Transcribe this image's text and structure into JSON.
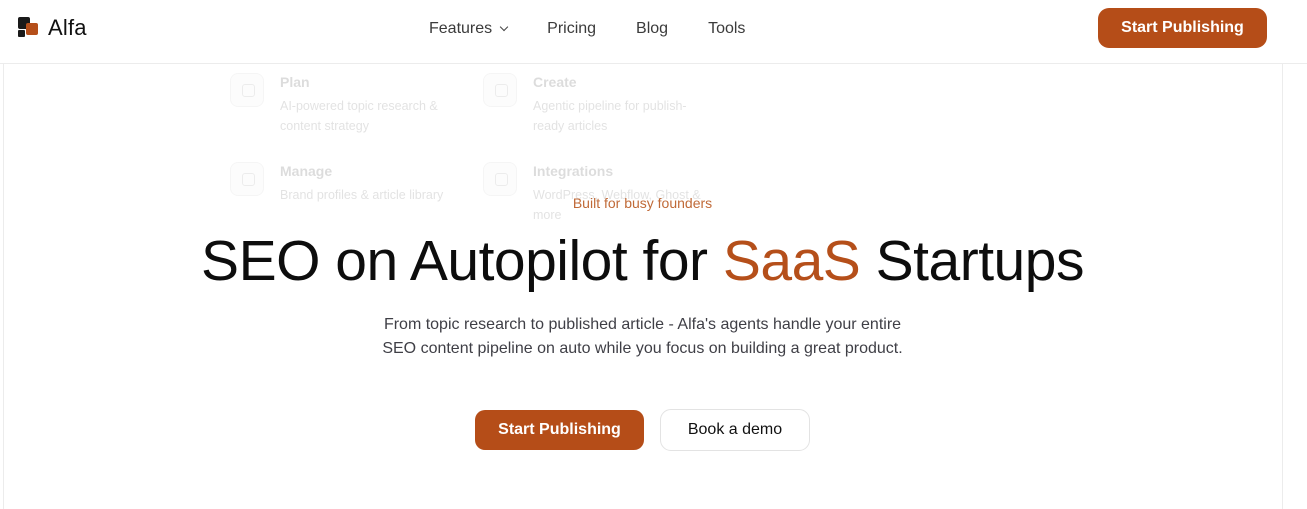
{
  "header": {
    "brand": "Alfa",
    "nav": [
      "Features",
      "Pricing",
      "Blog",
      "Tools"
    ],
    "cta": "Start Publishing"
  },
  "features_menu": [
    {
      "icon": "lightbulb-icon",
      "title": "Plan",
      "desc": "AI-powered topic research & content strategy"
    },
    {
      "icon": "pencil-icon",
      "title": "Create",
      "desc": "Agentic pipeline for publish-ready articles"
    },
    {
      "icon": "folder-icon",
      "title": "Manage",
      "desc": "Brand profiles & article library"
    },
    {
      "icon": "plug-icon",
      "title": "Integrations",
      "desc": "WordPress, Webflow, Ghost & more"
    }
  ],
  "hero": {
    "eyebrow": "Built for busy founders",
    "title_before": "SEO on Autopilot for ",
    "title_accent": "SaaS",
    "title_after": " Startups",
    "subtitle": "From topic research to published article - Alfa's agents handle your entire SEO content pipeline on auto while you focus on building a great product.",
    "primary_cta": "Start Publishing",
    "secondary_cta": "Book a demo"
  },
  "colors": {
    "accent": "#b54d18",
    "eyebrow": "#c06a38",
    "text": "#0d0d0d"
  }
}
